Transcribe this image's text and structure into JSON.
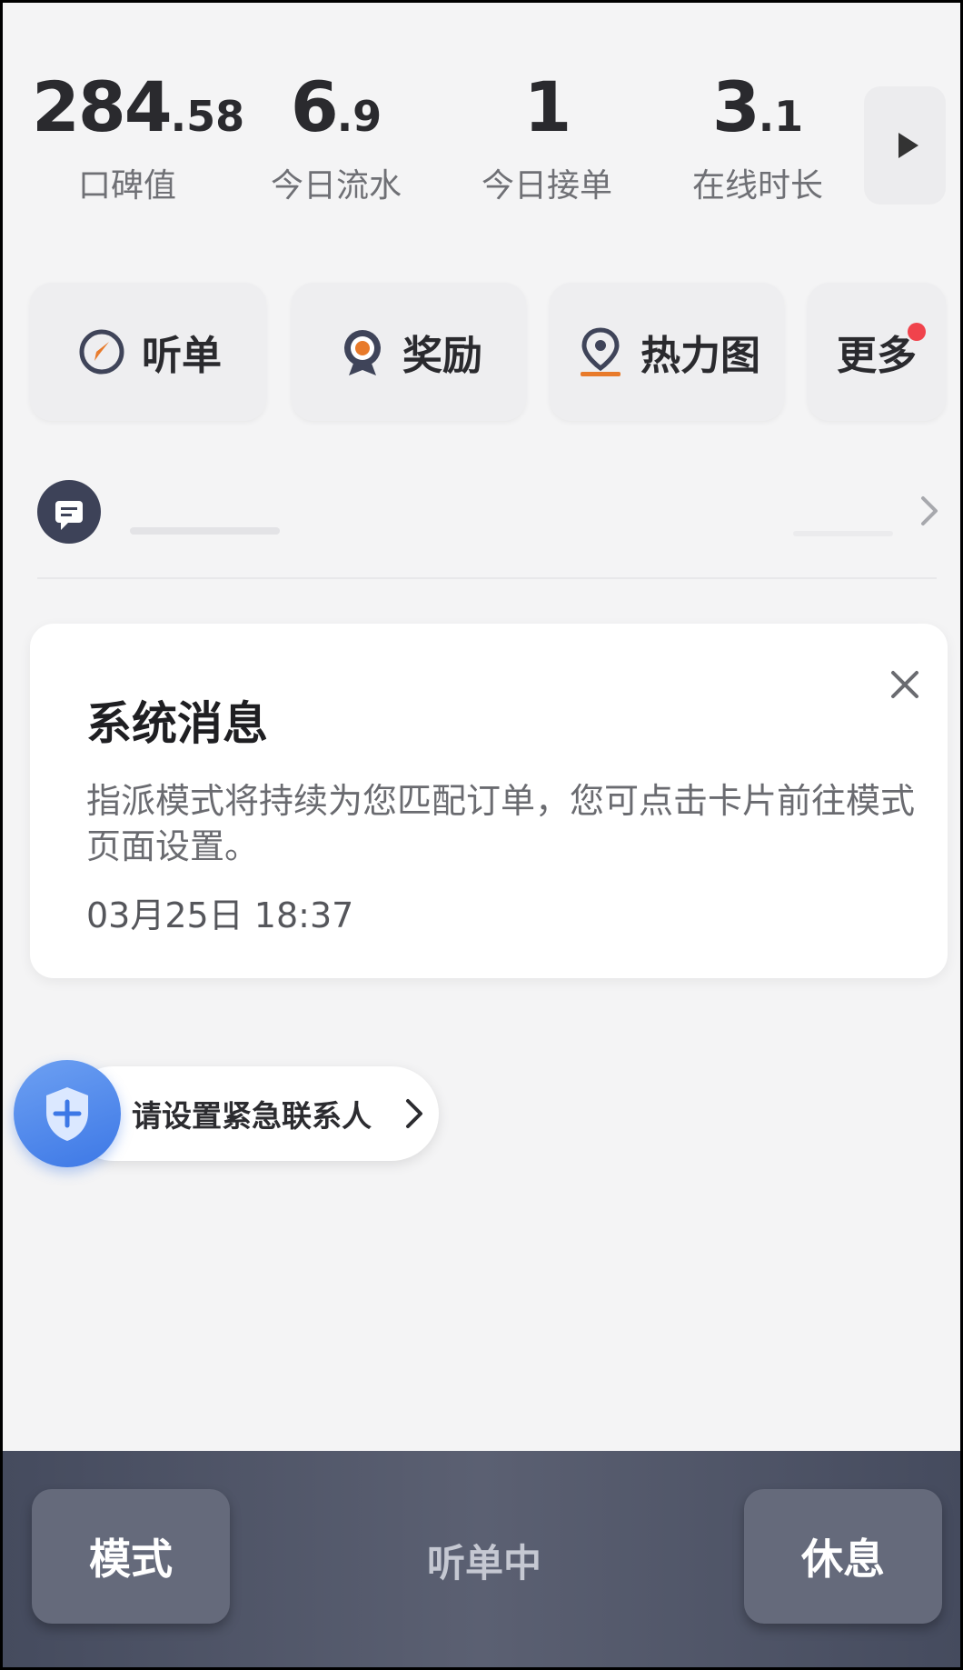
{
  "stats": [
    {
      "int": "284",
      "dec": ".58",
      "label": "口碑值"
    },
    {
      "int": "6",
      "dec": ".9",
      "label": "今日流水"
    },
    {
      "int": "1",
      "dec": "",
      "label": "今日接单"
    },
    {
      "int": "3",
      "dec": ".1",
      "label": "在线时长"
    }
  ],
  "stats_more_icon": "play-arrow-icon",
  "actions": [
    {
      "label": "听单",
      "icon": "compass-icon"
    },
    {
      "label": "奖励",
      "icon": "medal-icon"
    },
    {
      "label": "热力图",
      "icon": "map-pin-icon"
    },
    {
      "label": "更多",
      "icon": "notification-dot",
      "has_dot": true
    }
  ],
  "notice": {
    "icon": "chat-bubble-icon"
  },
  "system_message": {
    "title": "系统消息",
    "body": "指派模式将持续为您匹配订单，您可点击卡片前往模式页面设置。",
    "time": "03月25日 18:37"
  },
  "emergency": {
    "label": "请设置紧急联系人",
    "icon": "shield-plus-icon"
  },
  "bottom_bar": {
    "mode_label": "模式",
    "status_label": "听单中",
    "rest_label": "休息"
  },
  "colors": {
    "background": "#f4f4f5",
    "accent_orange": "#e87a2a",
    "accent_blue": "#3d78e6",
    "badge_red": "#f0434c",
    "bottom_bar": "#4f5467"
  }
}
